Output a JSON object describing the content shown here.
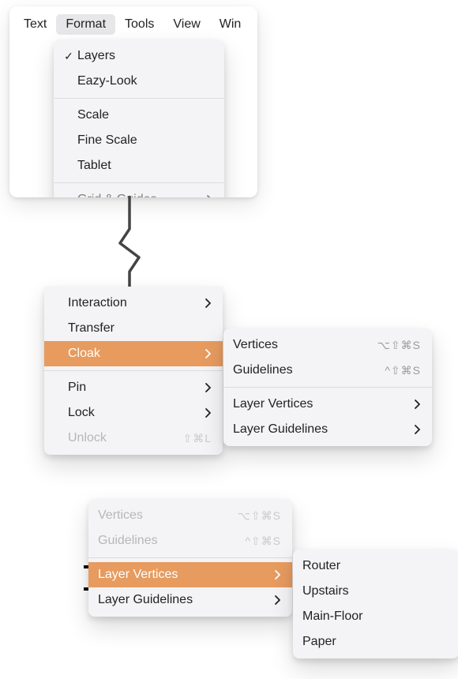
{
  "menubar": {
    "items": [
      "Text",
      "Format",
      "Tools",
      "View",
      "Win"
    ],
    "active_index": 1
  },
  "top_dropdown": {
    "items": [
      {
        "label": "Layers",
        "checked": true
      },
      {
        "label": "Eazy-Look"
      },
      {
        "sep": true
      },
      {
        "label": "Scale"
      },
      {
        "label": "Fine Scale"
      },
      {
        "label": "Tablet"
      },
      {
        "sep": true
      },
      {
        "label": "Grid & Guides",
        "submenu": true,
        "cut": true
      }
    ]
  },
  "mid_dropdown": {
    "items": [
      {
        "label": "Interaction",
        "submenu": true
      },
      {
        "label": "Transfer"
      },
      {
        "label": "Cloak",
        "submenu": true,
        "highlight": true
      },
      {
        "sep": true
      },
      {
        "label": "Pin",
        "submenu": true
      },
      {
        "label": "Lock",
        "submenu": true
      },
      {
        "label": "Unlock",
        "shortcut": "⇧⌘L",
        "disabled": true
      }
    ]
  },
  "mid_submenu": {
    "items": [
      {
        "label": "Vertices",
        "shortcut": "⌥⇧⌘S"
      },
      {
        "label": "Guidelines",
        "shortcut": "^⇧⌘S"
      },
      {
        "sep": true
      },
      {
        "label": "Layer Vertices",
        "submenu": true
      },
      {
        "label": "Layer Guidelines",
        "submenu": true
      }
    ]
  },
  "bottom_left": {
    "items": [
      {
        "label": "Vertices",
        "shortcut": "⌥⇧⌘S",
        "disabled": true
      },
      {
        "label": "Guidelines",
        "shortcut": "^⇧⌘S",
        "disabled": true
      },
      {
        "sep": true
      },
      {
        "label": "Layer Vertices",
        "submenu": true,
        "highlight": true
      },
      {
        "label": "Layer Guidelines",
        "submenu": true
      }
    ]
  },
  "bottom_right": {
    "items": [
      {
        "label": "Router"
      },
      {
        "label": "Upstairs"
      },
      {
        "label": "Main-Floor"
      },
      {
        "label": "Paper"
      }
    ]
  }
}
